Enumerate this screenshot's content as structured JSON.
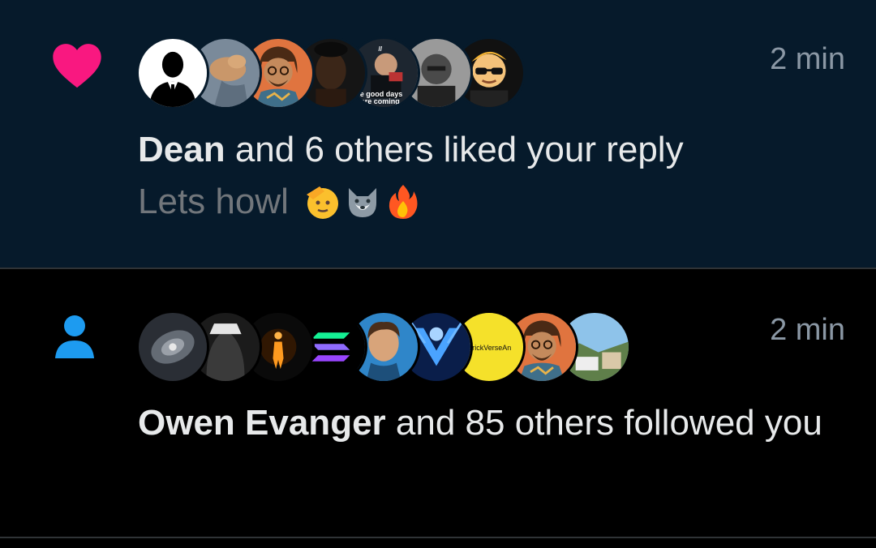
{
  "notifications": [
    {
      "type": "like",
      "icon": "heart-icon",
      "icon_color": "#f91880",
      "actor": "Dean",
      "action_text": " and 6 others liked your reply",
      "timestamp": "2 min",
      "reply_preview": "Lets howl",
      "reply_emojis": [
        "saluting-face-icon",
        "wolf-face-icon",
        "fire-icon"
      ],
      "avatars": [
        {
          "name": "silhouette-avatar",
          "overlay_text": ""
        },
        {
          "name": "dog-avatar",
          "overlay_text": ""
        },
        {
          "name": "cartoon-man-avatar",
          "overlay_text": ""
        },
        {
          "name": "woman-portrait-avatar",
          "overlay_text": ""
        },
        {
          "name": "man-quote-avatar",
          "overlay_text": "e good days are coming."
        },
        {
          "name": "man-bw-avatar",
          "overlay_text": ""
        },
        {
          "name": "sunglasses-cartoon-avatar",
          "overlay_text": ""
        }
      ]
    },
    {
      "type": "follow",
      "icon": "person-icon",
      "icon_color": "#1d9bf0",
      "actor": "Owen Evanger",
      "action_text": " and 85 others followed you",
      "timestamp": "2 min",
      "avatars": [
        {
          "name": "galaxy-avatar",
          "overlay_text": ""
        },
        {
          "name": "hooded-figure-avatar",
          "overlay_text": ""
        },
        {
          "name": "glowing-figure-avatar",
          "overlay_text": ""
        },
        {
          "name": "solana-logo-avatar",
          "overlay_text": ""
        },
        {
          "name": "man-portrait-avatar",
          "overlay_text": ""
        },
        {
          "name": "blue-tech-logo-avatar",
          "overlay_text": ""
        },
        {
          "name": "crickversean-avatar",
          "overlay_text": "CrickVerseAn"
        },
        {
          "name": "cartoon-man-avatar",
          "overlay_text": ""
        },
        {
          "name": "landscape-avatar",
          "overlay_text": ""
        }
      ]
    }
  ]
}
